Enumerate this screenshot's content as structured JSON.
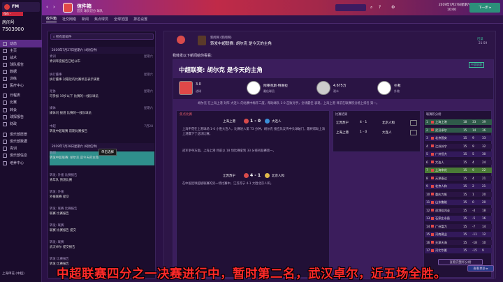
{
  "sidebar": {
    "club": "保存 -",
    "header_label": "房间号",
    "room_number": "7503900",
    "items": [
      {
        "label": "动态"
      },
      {
        "label": "主页"
      },
      {
        "label": "战术"
      },
      {
        "label": "球队报告"
      },
      {
        "label": "数据"
      },
      {
        "label": "训练"
      },
      {
        "label": "医疗中心"
      },
      {
        "label": "日程表"
      },
      {
        "label": "比赛"
      },
      {
        "label": "转会"
      },
      {
        "label": "球探报告"
      },
      {
        "label": "财政"
      },
      {
        "label": "俱乐部愿景"
      },
      {
        "label": "俱乐部数据"
      },
      {
        "label": "青训"
      },
      {
        "label": "俱乐部信息"
      },
      {
        "label": "培养中心"
      }
    ],
    "footer": "上海申花 (中超)"
  },
  "topbar": {
    "title": "信件箱",
    "subtitle": "首页 球员记分 球队",
    "date": "2019年7月27日星期六",
    "time": "10:00",
    "continue": "下一步 ▸"
  },
  "subnav": {
    "tabs": [
      "收件箱",
      "社交网络",
      "新闻",
      "焦点球员",
      "全球范围",
      "排名设置"
    ]
  },
  "list": {
    "search": "所有新邮件",
    "group1": "2019年7月27日星期六 (4封信件)",
    "group2": "2019年7月28日星期六 (8封信件)",
    "messages": [
      {
        "cat": "青训",
        "title": "青训年度报告已经公布",
        "date": "星期六"
      },
      {
        "cat": "执行董事",
        "title": "执行董事 对最近的比赛状态表示满意",
        "date": "星期六"
      },
      {
        "cat": "足协",
        "title": "可参加 19岁以下 比赛的一线队球员",
        "date": "星期六"
      },
      {
        "cat": "媒体",
        "title": "媒体问 报道 比赛的一线队球员",
        "date": "星期六"
      },
      {
        "cat": "中超",
        "title": "转发中超联赛 前期比赛报告",
        "date": "7月28"
      },
      {
        "cat": "新闻",
        "title": "转发中超联赛: 胡尔克 是今天的主角",
        "date": ""
      },
      {
        "cat": "转发: 外援 比赛报告",
        "title": "青年队 预测比赛",
        "date": ""
      },
      {
        "cat": "转发: 外援",
        "title": "外援联赛 提交",
        "date": ""
      },
      {
        "cat": "转发: 联赛 比赛报告",
        "title": "联赛 比赛报告",
        "date": ""
      },
      {
        "cat": "转发: 联赛",
        "title": "联赛 比赛报告 提交",
        "date": ""
      },
      {
        "cat": "转发: 联赛",
        "title": "武汉卓尔 提交报告",
        "date": ""
      },
      {
        "cat": "转发 比赛报告",
        "title": "转发 比赛报告",
        "date": ""
      }
    ],
    "tooltip": "单击选择"
  },
  "main": {
    "sender": "新闻网 (新闻网)",
    "headline_small": "转发中超联赛: 胡尔克 是今天的主角",
    "status": "已读",
    "time": "21:59",
    "intro": "我转发以下新闻给你看看:",
    "article_title": "中超联赛: 胡尔克 是今天的主角",
    "stats": [
      {
        "value": "3.0",
        "label": "进球"
      },
      {
        "value": "阿莱克斯·特谢拉",
        "label": "最佳球员"
      },
      {
        "value": "4.675万",
        "label": "观众"
      },
      {
        "value": "扑救",
        "label": "扑救"
      }
    ],
    "body_text": "胡尔克 在上海上港 对阵 大连人 的比赛中梅开二度，帮助球队 1-0 击败对手，全场最佳 表现，上海上港 目前在联赛积分榜上排名 第一。",
    "match_title": "焦点比赛",
    "match": {
      "home": "上海上港",
      "score": "1 - 0",
      "away": "大连人"
    },
    "report1": "上海申花在上港球场 1-0 小胜大连人，比赛进入第 73 分钟，胡尔克 接应队友传中头球破门，最终帮助上海上港赢下了这场比赛。",
    "report2": "冠军争夺方面，上海上港 目前以 18 场比赛拿到 33 分排名联赛第一。",
    "match2": {
      "home": "江苏苏宁",
      "score": "4 - 1",
      "away": "北京人和"
    },
    "report3": "在中国足球超级联赛的另一场比赛中，江苏苏宁 4-1 大胜北京人和。",
    "results_title": "比赛结果",
    "results": [
      {
        "home": "江苏苏宁",
        "score": "4 - 1",
        "away": "北京人和"
      },
      {
        "home": "上海上港",
        "score": "1 - 0",
        "away": "大连人"
      }
    ],
    "table_title": "联赛积分榜",
    "table": [
      {
        "pos": "1",
        "team": "上海上港",
        "p": "18",
        "w": "33",
        "pts": "39"
      },
      {
        "pos": "2",
        "team": "武汉卓尔",
        "p": "15",
        "w": "14",
        "pts": "36"
      },
      {
        "pos": "3",
        "team": "北京国安",
        "p": "15",
        "w": "9",
        "pts": "33"
      },
      {
        "pos": "4",
        "team": "江苏苏宁",
        "p": "15",
        "w": "9",
        "pts": "32"
      },
      {
        "pos": "5",
        "team": "广州恒大",
        "p": "15",
        "w": "5",
        "pts": "30"
      },
      {
        "pos": "6",
        "team": "大连人",
        "p": "15",
        "w": "4",
        "pts": "24"
      },
      {
        "pos": "7",
        "team": "上海申花",
        "p": "15",
        "w": "9",
        "pts": "22"
      },
      {
        "pos": "8",
        "team": "天津泰达",
        "p": "15",
        "w": "4",
        "pts": "21"
      },
      {
        "pos": "9",
        "team": "北京人和",
        "p": "15",
        "w": "2",
        "pts": "21"
      },
      {
        "pos": "10",
        "team": "重庆力帆",
        "p": "15",
        "w": "1",
        "pts": "20"
      },
      {
        "pos": "11",
        "team": "山东鲁能",
        "p": "15",
        "w": "0",
        "pts": "20"
      },
      {
        "pos": "12",
        "team": "深圳佳兆业",
        "p": "15",
        "w": "-4",
        "pts": "18"
      },
      {
        "pos": "13",
        "team": "石家庄永昌",
        "p": "15",
        "w": "-5",
        "pts": "16"
      },
      {
        "pos": "14",
        "team": "广州富力",
        "p": "15",
        "w": "-7",
        "pts": "14"
      },
      {
        "pos": "15",
        "team": "河南建业",
        "p": "15",
        "w": "-11",
        "pts": "12"
      },
      {
        "pos": "16",
        "team": "天津天海",
        "p": "15",
        "w": "-18",
        "pts": "10"
      },
      {
        "pos": "17",
        "team": "河北华夏",
        "p": "15",
        "w": "-15",
        "pts": "9"
      }
    ],
    "view_table": "查看完整积分榜",
    "view_more": "查看更多 ▸"
  },
  "subtitle": "中超联赛四分之一决赛进行中，暂时第二名，武汉卓尔，近五场全胜。"
}
